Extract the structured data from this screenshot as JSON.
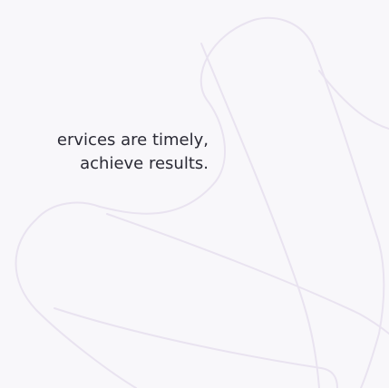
{
  "content": {
    "text_lines": [
      "ervices are timely,",
      "achieve results."
    ]
  },
  "decoration": {
    "stroke_color": "#e9e3f0",
    "background_color": "#f8f7fa"
  }
}
